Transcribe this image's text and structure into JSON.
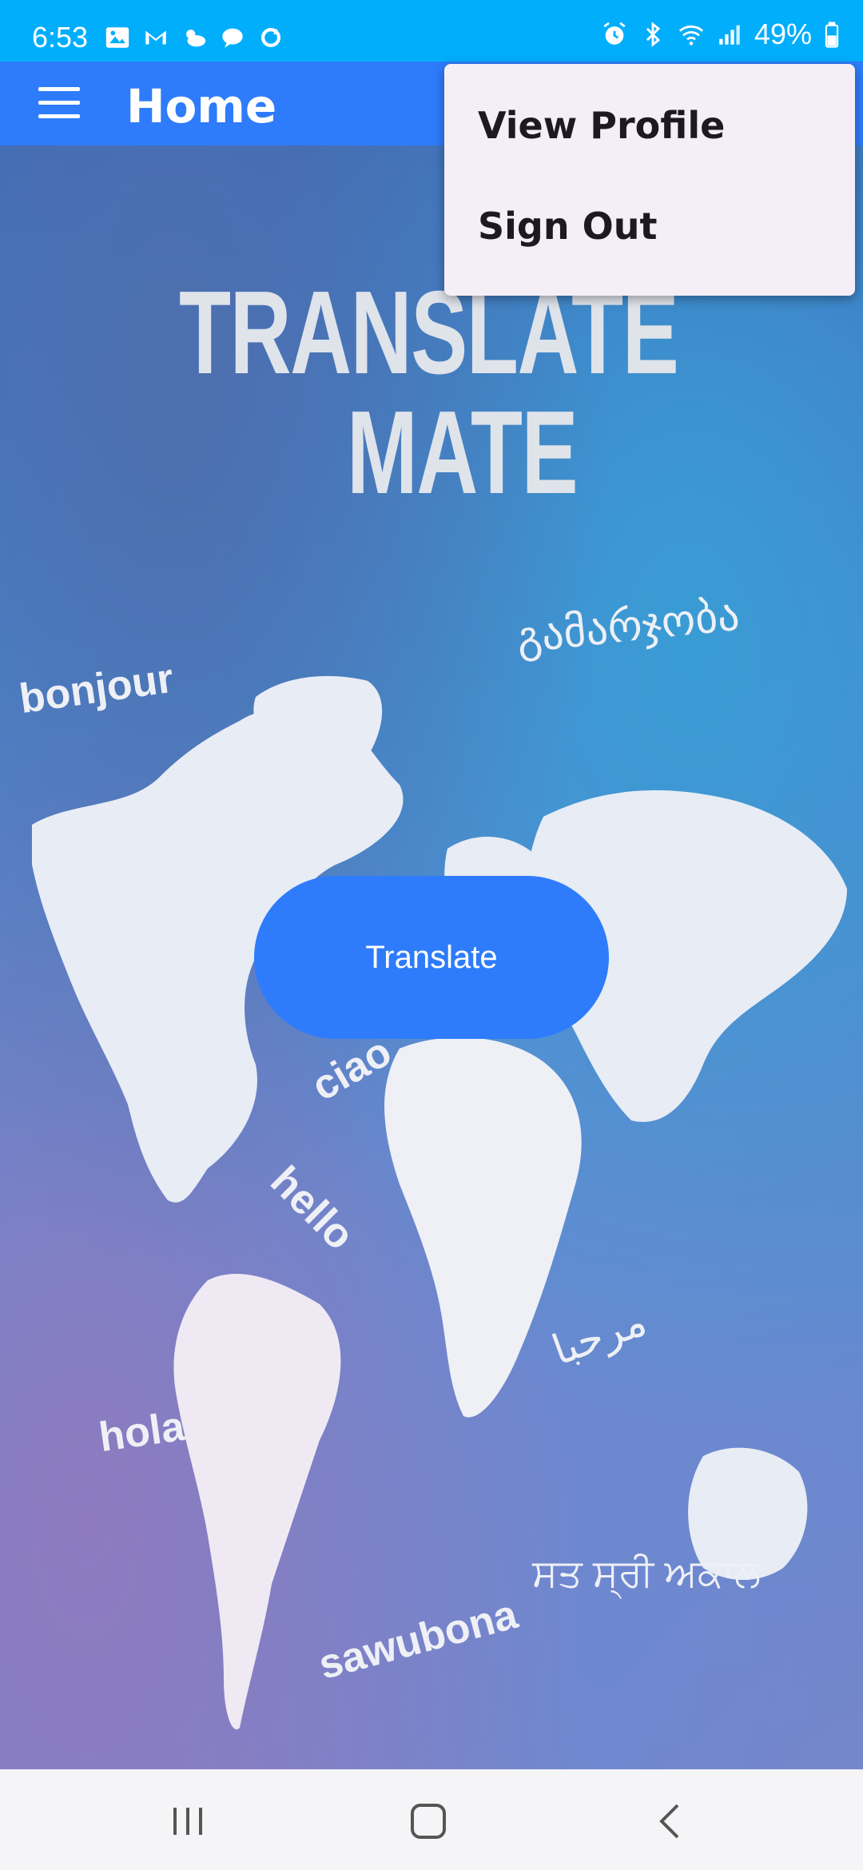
{
  "status_bar": {
    "time": "6:53",
    "battery": "49%"
  },
  "app_bar": {
    "title": "Home"
  },
  "art": {
    "logo_line1": "TRANSLATE",
    "logo_line2": "MATE",
    "greetings": [
      "bonjour",
      "ciao",
      "hello",
      "hola",
      "sawubona",
      "გამარჯობა",
      "ਸਤ ਸ੍ਰੀ ਅਕਾਲ",
      "مرحبا"
    ]
  },
  "main": {
    "translate_label": "Translate"
  },
  "popup_menu": {
    "items": [
      "View Profile",
      "Sign Out"
    ]
  },
  "colors": {
    "status_bar": "#01aefc",
    "app_bar": "#2e7cfb",
    "button": "#2e7cfb",
    "popup": "#f4eef6"
  }
}
